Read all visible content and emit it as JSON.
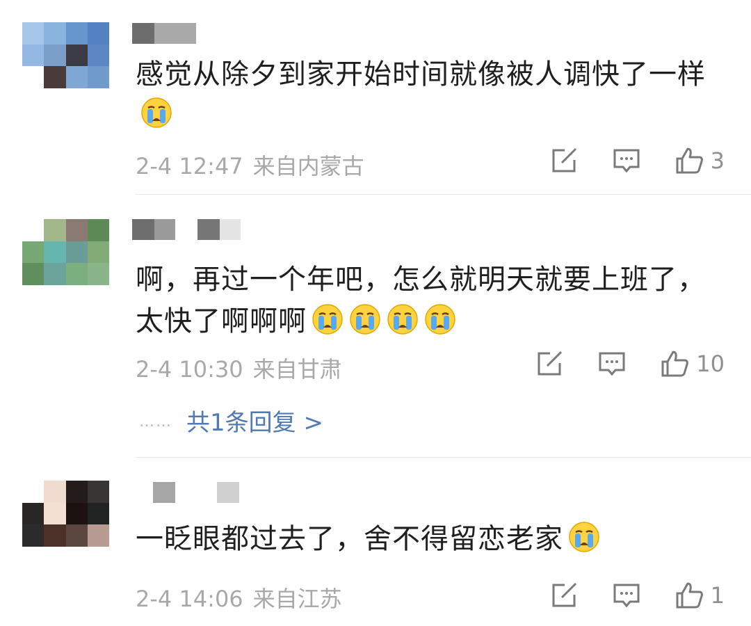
{
  "comments": [
    {
      "text": "感觉从除夕到家开始时间就像被人调快了一样",
      "emoji_count": 1,
      "time": "2-4 12:47",
      "location": "来自内蒙古",
      "likes": "3",
      "avatar_colors": [
        "#a5c8ea",
        "#8ab3e0",
        "#6796cf",
        "#5382c3",
        "#93b8e3",
        "#7a9fc9",
        "#3b3b45",
        "#5c86c4",
        "#ffffff",
        "#4a3a3a",
        "#7ea7d6",
        "#7099cc"
      ],
      "username_colors": [
        "#6d6d6d",
        "#a9a9a9"
      ]
    },
    {
      "text": "啊，再过一个年吧，怎么就明天就要上班了，太快了啊啊啊",
      "emoji_count": 4,
      "time": "2-4 10:30",
      "location": "来自甘肃",
      "likes": "10",
      "avatar_colors": [
        "#ffffff",
        "#a3b88a",
        "#8b7a74",
        "#5e8a58",
        "#76a874",
        "#66b6b0",
        "#6b9d98",
        "#83ab78",
        "#5f8e5f",
        "#6ca39b",
        "#7caf7f",
        "#8ab48a"
      ],
      "username_colors": [
        "#6e6e6e",
        "#9a9a9a",
        "#ffffff",
        "#777777",
        "#e5e5e5"
      ]
    },
    {
      "text": "一眨眼都过去了，舍不得留恋老家",
      "emoji_count": 1,
      "time": "2-4 14:06",
      "location": "来自江苏",
      "likes": "1",
      "avatar_colors": [
        "#ffffff",
        "#f1dbd0",
        "#241b1b",
        "#3a3535",
        "#2a2626",
        "#f3e0d3",
        "#1c1310",
        "#1f2322",
        "#2b2b2b",
        "#4b3128",
        "#5b4640",
        "#b89b93"
      ],
      "username_colors": [
        "#a6a6a6",
        "#ffffff",
        "#d0d0d0"
      ]
    }
  ],
  "reply": {
    "dots": "……",
    "label": "共1条回复 >"
  },
  "colors": {
    "link": "#4f7ab3",
    "meta": "#a8a8a8",
    "divider": "#e8e8e8"
  },
  "icons": {
    "share": "share-edit-icon",
    "comment": "comment-bubble-icon",
    "like": "thumbs-up-icon",
    "emoji": "crying-face-emoji"
  }
}
